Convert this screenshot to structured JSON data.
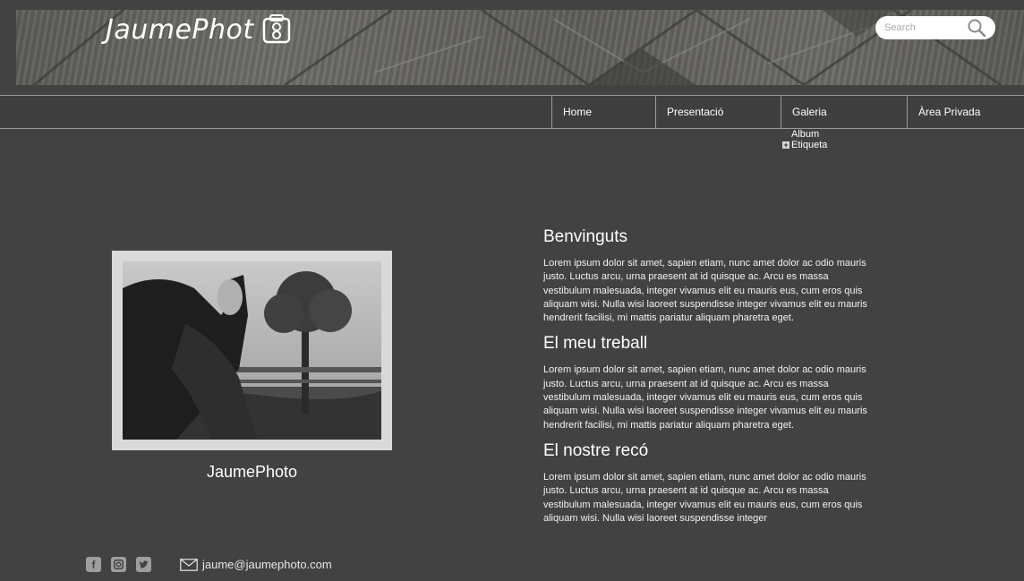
{
  "header": {
    "logo_text": "JaumePhot",
    "search": {
      "placeholder": "Search"
    }
  },
  "nav": {
    "items": [
      {
        "label": "Home"
      },
      {
        "label": "Presentació"
      },
      {
        "label": "Galeria"
      },
      {
        "label": "Àrea Privada"
      }
    ],
    "submenu": [
      {
        "label": "Album"
      },
      {
        "label": "Etiqueta"
      }
    ]
  },
  "profile": {
    "caption": "JaumePhoto",
    "email": "jaume@jaumephoto.com",
    "social_icons": [
      "facebook-icon",
      "instagram-icon",
      "twitter-icon"
    ]
  },
  "sections": [
    {
      "title": "Benvinguts",
      "body": "Lorem ipsum dolor sit amet, sapien etiam, nunc amet dolor ac odio mauris justo. Luctus arcu, urna praesent at id quisque ac. Arcu es massa vestibulum malesuada, integer vivamus elit eu mauris eus, cum eros quis aliquam wisi. Nulla wisi laoreet suspendisse integer vivamus elit eu mauris hendrerit facilisi, mi mattis pariatur aliquam pharetra eget."
    },
    {
      "title": "El meu treball",
      "body": "Lorem ipsum dolor sit amet, sapien etiam, nunc amet dolor ac odio mauris justo. Luctus arcu, urna praesent at id quisque ac. Arcu es massa vestibulum malesuada, integer vivamus elit eu mauris eus, cum eros quis aliquam wisi. Nulla wisi laoreet suspendisse integer vivamus elit eu mauris hendrerit facilisi, mi mattis pariatur aliquam pharetra eget."
    },
    {
      "title": "El nostre recó",
      "body": "Lorem ipsum dolor sit amet, sapien etiam, nunc amet dolor ac odio mauris justo. Luctus arcu, urna praesent at id quisque ac. Arcu es massa vestibulum malesuada, integer vivamus elit eu mauris eus, cum eros quis aliquam wisi. Nulla wisi laoreet suspendisse integer"
    }
  ],
  "colors": {
    "background": "#424242",
    "nav_border": "#9a9a9a",
    "photo_frame": "#d9d9d9"
  }
}
